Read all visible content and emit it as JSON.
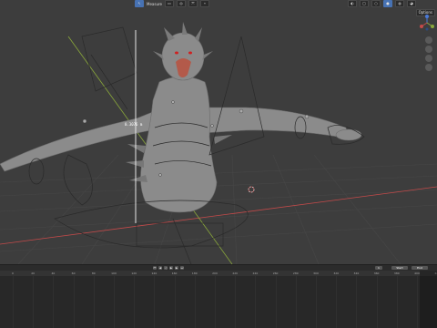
{
  "header": {
    "mode_label": "Measure",
    "options_label": "Options"
  },
  "viewport": {
    "measurement_text": "0.3076 m"
  },
  "timeline": {
    "current_frame": "1",
    "start_label": "Start",
    "end_label": "End",
    "ruler_ticks": [
      "0",
      "20",
      "40",
      "60",
      "80",
      "100",
      "120",
      "140",
      "160",
      "180",
      "200",
      "220",
      "240",
      "260",
      "280",
      "300",
      "320",
      "340",
      "360",
      "380",
      "400",
      "420"
    ]
  },
  "colors": {
    "accent": "#4772b3",
    "axis_x": "#c44a4a",
    "axis_y": "#8aa83b",
    "measure_line": "#e8e8e8"
  },
  "icons": [
    "cursor-icon",
    "select-icon",
    "view-icon",
    "gizmo-icon",
    "zoom-icon",
    "pan-icon",
    "camera-icon",
    "grid-icon",
    "play-icon",
    "jump-start-icon",
    "jump-end-icon",
    "step-back-icon",
    "step-forward-icon"
  ]
}
